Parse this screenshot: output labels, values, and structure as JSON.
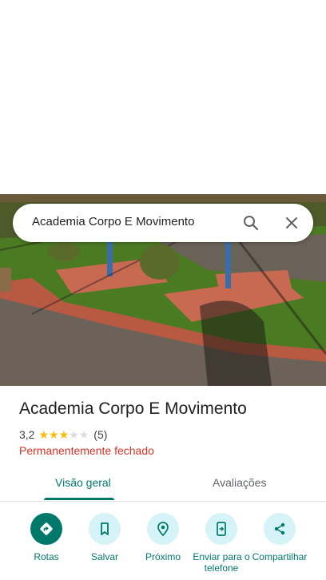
{
  "search": {
    "query": "Academia Corpo E Movimento"
  },
  "place": {
    "title": "Academia Corpo E Movimento",
    "rating_value": "3,2",
    "rating_stars": 3,
    "review_count": "(5)",
    "status": "Permanentemente fechado"
  },
  "tabs": [
    {
      "label": "Visão geral"
    },
    {
      "label": "Avaliações"
    }
  ],
  "actions": [
    {
      "label": "Rotas",
      "icon": "directions-icon"
    },
    {
      "label": "Salvar",
      "icon": "bookmark-icon"
    },
    {
      "label": "Próximo",
      "icon": "nearby-icon"
    },
    {
      "label": "Enviar para o telefone",
      "icon": "send-to-phone-icon"
    },
    {
      "label": "Compartilhar",
      "icon": "share-icon"
    }
  ],
  "colors": {
    "accent": "#00796b",
    "accent_light": "#d6f4f8",
    "status_red": "#d93025",
    "star": "#fbbc04"
  }
}
